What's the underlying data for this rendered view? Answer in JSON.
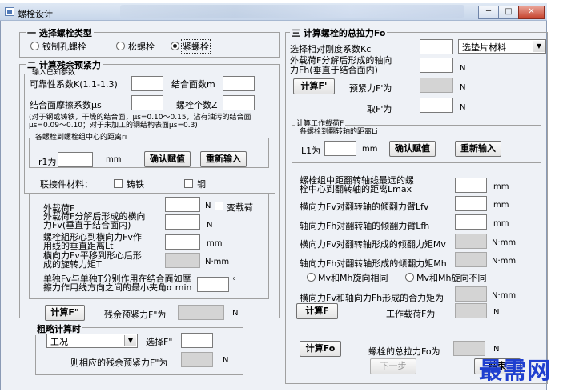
{
  "window": {
    "title": "螺栓设计",
    "buttons": {
      "minimize": "─",
      "maximize": "□",
      "close": "✕"
    }
  },
  "bolt_type": {
    "title": "一 选择螺栓类型",
    "options": [
      "铰制孔螺栓",
      "松螺栓",
      "紧螺栓"
    ],
    "selected": "紧螺栓"
  },
  "preload": {
    "title": "二 计算残余预紧力",
    "known_title": "输入已知参数",
    "reliability_label": "可靠性系数K(1.1-1.3)",
    "surfaces_label": "结合面数m",
    "friction_label": "结合面摩擦系数μs",
    "bolt_count_label": "螺栓个数Z",
    "friction_note_1": "(对于钢或铸铁，干燥的结合面，μs=0.10～0.15，沾有油污的结合面",
    "friction_note_2": "μs=0.09～0.10；对于未加工的钢结构表面μs=0.3)",
    "distance_title": "各螺栓到螺栓组中心的距离ri",
    "r1_label": "r1为",
    "r1_unit": "mm",
    "confirm_button": "确认赋值",
    "reinput_button": "重新输入",
    "material_label": "联接件材料：",
    "material_cast_iron": "铸铁",
    "material_steel": "钢",
    "external_load_label": "外载荷F",
    "external_load_unit": "N",
    "variable_load_label": "变载荷",
    "transverse_label_1": "外载荷F分解后形成的横向",
    "transverse_label_2": "力Fv(垂直于结合面内)",
    "transverse_unit": "N",
    "perp_dist_label_1": "螺栓組形心到横向力Fv作",
    "perp_dist_label_2": "用线的垂直距离Lt",
    "perp_dist_unit": "mm",
    "torque_label_1": "横向力Fv平移到形心后形",
    "torque_label_2": "成的旋转力矩T",
    "torque_unit": "N·mm",
    "angle_label_1": "单独Fv与单独T分别作用在结合面如摩",
    "angle_label_2": "擦力作用线方向之间的最小夹角α min",
    "angle_unit": "°",
    "calc_button": "计算F\"",
    "residual_label": "残余预紧力F\"为",
    "residual_unit": "N"
  },
  "rough": {
    "title": "粗略计算时",
    "condition_value": "工况",
    "select_label": "选择F\"",
    "result_label": "则相应的残余预紧力F\"为",
    "result_unit": "N"
  },
  "total": {
    "title": "三 计算螺栓的总拉力Fo",
    "stiffness_label": "选择相对刚度系数Kc",
    "gasket_value": "选垫片材料",
    "axial_label_1": "外载荷F分解后形成的轴向",
    "axial_label_2": "力Fh(垂直于结合面内)",
    "axial_unit": "N",
    "calc_fp_button": "计算F'",
    "preload_label": "预紧力F'为",
    "preload_unit": "N",
    "take_label": "取F'为",
    "take_unit": "N",
    "work_title": "计算工作载荷F",
    "li_title": "各螺栓到翻转轴的距离Li",
    "l1_label": "L1为",
    "l1_unit": "mm",
    "confirm_button": "确认赋值",
    "reinput_button": "重新输入",
    "lmax_label_1": "螺栓组中距翻转轴线最远的螺",
    "lmax_label_2": "栓中心到翻转轴的距离Lmax",
    "lmax_unit": "mm",
    "lfv_label": "横向力Fv对翻转轴的倾翻力臂Lfv",
    "lfv_unit": "mm",
    "lfh_label": "轴向力Fh对翻转轴的倾翻力臂Lfh",
    "lfh_unit": "mm",
    "mv_label": "横向力Fv对翻转轴形成的倾翻力矩Mv",
    "mv_unit": "N·mm",
    "mh_label": "轴向力Fh对翻转轴形成的倾翻力矩Mh",
    "mh_unit": "N·mm",
    "same_dir": "Mv和Mh旋向相同",
    "diff_dir": "Mv和Mh旋向不同",
    "resultant_label": "横向力Fv和轴向力Fh形成的合力矩为",
    "resultant_unit": "N·mm",
    "calc_f_button": "计算F",
    "work_load_label": "工作载荷F为",
    "work_load_unit": "N",
    "calc_fo_button": "计算Fo",
    "total_label": "螺栓的总拉力Fo为",
    "total_unit": "N",
    "next_button": "下一步",
    "finish_button": "结束"
  },
  "watermark": "最需网",
  "colors": {
    "window_bg": "#eef1f6",
    "disabled_field": "#d4d4d4",
    "watermark": "#1f3fcf"
  }
}
